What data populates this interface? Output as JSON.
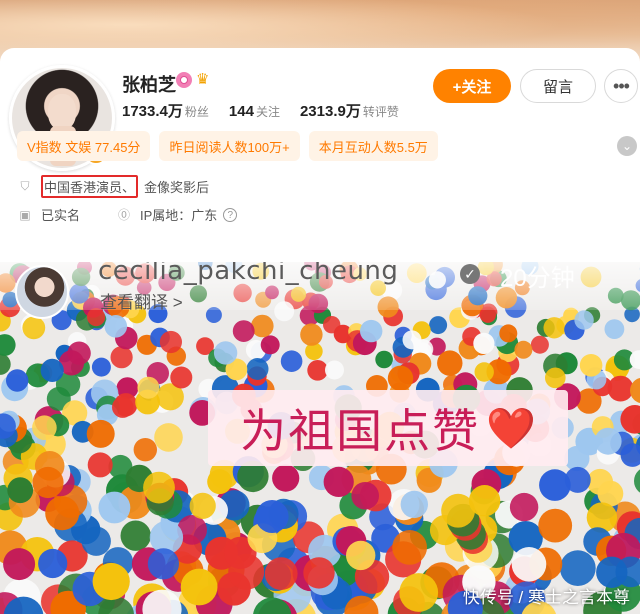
{
  "profile": {
    "name": "张柏芝",
    "verified_icon": "v-badge-icon",
    "stats": [
      {
        "value": "1733.4万",
        "label": "粉丝"
      },
      {
        "value": "144",
        "label": "关注"
      },
      {
        "value": "2313.9万",
        "label": "转评赞"
      }
    ],
    "actions": {
      "follow": "+关注",
      "message": "留言",
      "more": "•••"
    },
    "tags": [
      "V指数 文娱 77.45分",
      "昨日阅读人数100万+",
      "本月互动人数5.5万"
    ],
    "occupation_highlight": "中国香港演员、",
    "occupation_rest": "金像奖影后",
    "real_name": "已实名",
    "ip_location": "IP属地：广东",
    "colors": {
      "accent": "#ff8200",
      "tag_bg": "#fff3e6",
      "highlight_border": "#e32a2a"
    }
  },
  "post": {
    "username": "cecilia_pakchi_cheung",
    "time": "20分钟",
    "translate": "查看翻译 >",
    "caption": "为祖国点赞",
    "heart": "❤️"
  },
  "watermark": "快传号 / 寒士之言本尊"
}
